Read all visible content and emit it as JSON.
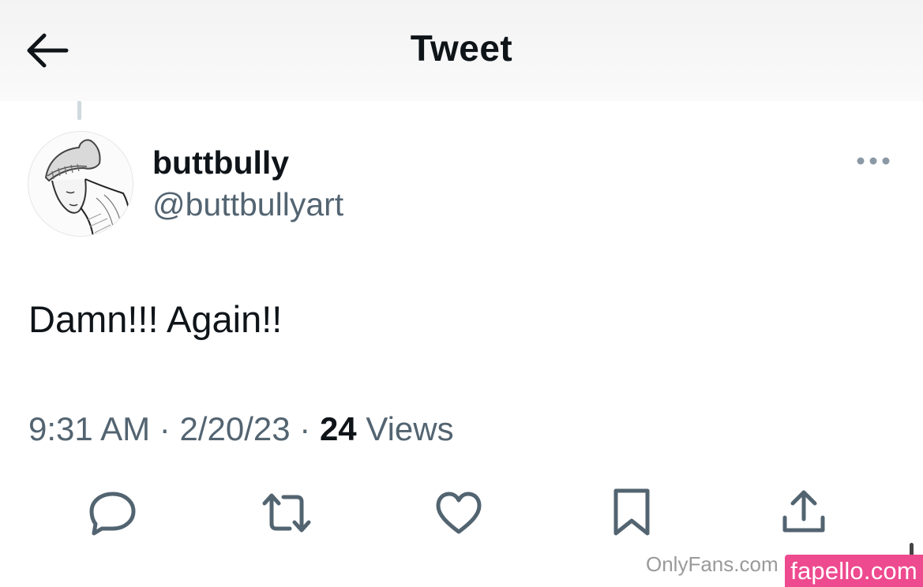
{
  "header": {
    "title": "Tweet",
    "back_icon": "arrow-left-icon"
  },
  "tweet": {
    "author": {
      "display_name": "buttbully",
      "handle": "@buttbullyart"
    },
    "text": "Damn!!! Again!!",
    "meta": {
      "time": "9:31 AM",
      "separator": "·",
      "date": "2/20/23",
      "views_count": "24",
      "views_label": "Views"
    },
    "actions": [
      {
        "name": "reply",
        "icon": "reply-icon"
      },
      {
        "name": "retweet",
        "icon": "retweet-icon"
      },
      {
        "name": "like",
        "icon": "heart-icon"
      },
      {
        "name": "bookmark",
        "icon": "bookmark-icon"
      },
      {
        "name": "share",
        "icon": "share-icon"
      }
    ]
  },
  "watermarks": {
    "source": "OnlyFans.com",
    "site": "fapello.com"
  },
  "colors": {
    "text_primary": "#0f1419",
    "text_secondary": "#536471",
    "watermark_badge": "#ee4a8f"
  }
}
